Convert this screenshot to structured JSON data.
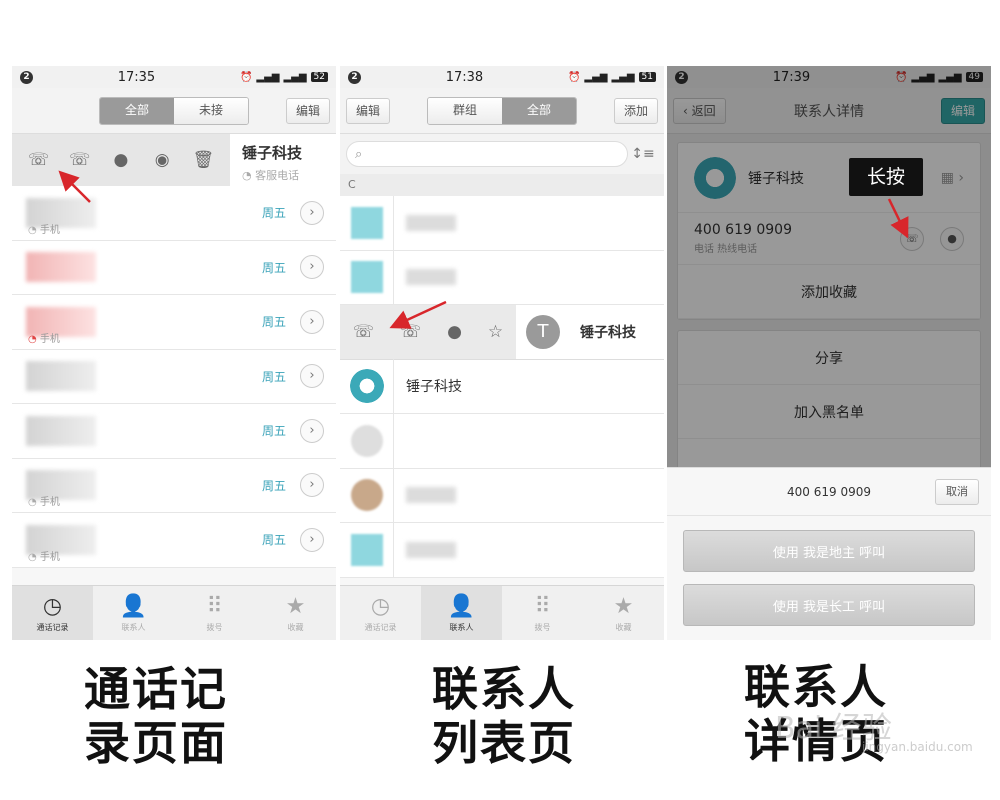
{
  "panel1": {
    "status": {
      "notify": "2",
      "time": "17:35",
      "battery": "52"
    },
    "nav": {
      "seg_all": "全部",
      "seg_missed": "未接",
      "edit": "编辑"
    },
    "action_contact": {
      "name": "锤子科技",
      "sub": "客服电话"
    },
    "calls": [
      {
        "type": "手机",
        "day": "周五"
      },
      {
        "type": "",
        "day": "周五"
      },
      {
        "type": "手机",
        "day": "周五"
      },
      {
        "type": "",
        "day": "周五"
      },
      {
        "type": "",
        "day": "周五"
      },
      {
        "type": "手机",
        "day": "周五"
      },
      {
        "type": "手机",
        "day": "周五"
      }
    ],
    "tabs": {
      "calls": "通话记录",
      "contacts": "联系人",
      "dial": "拨号",
      "fav": "收藏"
    }
  },
  "panel2": {
    "status": {
      "notify": "2",
      "time": "17:38",
      "battery": "51"
    },
    "nav": {
      "edit": "编辑",
      "seg_groups": "群组",
      "seg_all": "全部",
      "add": "添加"
    },
    "section": "C",
    "action_contact": {
      "avatar_letter": "T",
      "name": "锤子科技"
    },
    "contact_name": "锤子科技",
    "tabs": {
      "calls": "通话记录",
      "contacts": "联系人",
      "dial": "拨号",
      "fav": "收藏"
    }
  },
  "panel3": {
    "status": {
      "notify": "2",
      "time": "17:39",
      "battery": "49"
    },
    "nav": {
      "back": "返回",
      "title": "联系人详情",
      "edit": "编辑"
    },
    "card": {
      "name": "锤子科技",
      "phone": "400 619 0909",
      "phone_sub": "电话 热线电话",
      "add_fav": "添加收藏"
    },
    "menu": {
      "share": "分享",
      "blacklist": "加入黑名单"
    },
    "sheet": {
      "number": "400 619 0909",
      "cancel": "取消",
      "option1": "使用 我是地主 呼叫",
      "option2": "使用 我是长工 呼叫"
    },
    "callout": "长按"
  },
  "captions": {
    "cap1_line1": "通话记",
    "cap1_line2": "录页面",
    "cap2_line1": "联系人",
    "cap2_line2": "列表页",
    "cap3_line1": "联系人",
    "cap3_line2": "详情页"
  },
  "watermark": {
    "main": "Bai 经验",
    "sub": "jingyan.baidu.com"
  },
  "colors": {
    "accent_teal": "#36a8a8",
    "day_blue": "#3ba3b9",
    "arrow_red": "#d8262b"
  }
}
